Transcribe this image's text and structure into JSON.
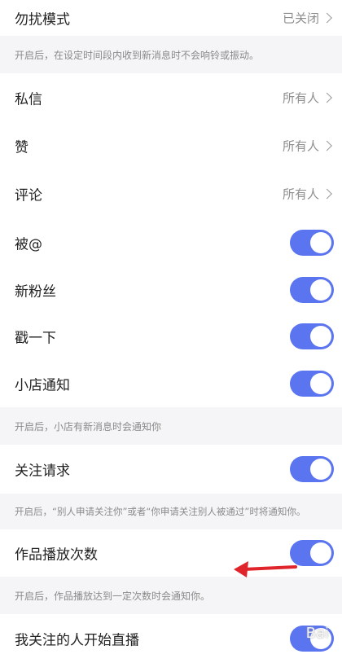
{
  "rows": {
    "dnd": {
      "label": "勿扰模式",
      "value": "已关闭"
    },
    "dnd_hint": "开启后，在设定时间段内收到新消息时不会响铃或振动。",
    "dm": {
      "label": "私信",
      "value": "所有人"
    },
    "likes": {
      "label": "赞",
      "value": "所有人"
    },
    "comments": {
      "label": "评论",
      "value": "所有人"
    },
    "mention": {
      "label": "被@",
      "toggle": true
    },
    "fans": {
      "label": "新粉丝",
      "toggle": true
    },
    "poke": {
      "label": "戳一下",
      "toggle": true
    },
    "shop": {
      "label": "小店通知",
      "toggle": true
    },
    "shop_hint": "开启后，小店有新消息时会通知你",
    "follow_req": {
      "label": "关注请求",
      "toggle": true
    },
    "follow_hint": "开启后，“别人申请关注你”或者“你申请关注别人被通过”时将通知你。",
    "plays": {
      "label": "作品播放次数",
      "toggle": true
    },
    "plays_hint": "开启后，作品播放达到一定次数时会通知你。",
    "live": {
      "label": "我关注的人开始直播",
      "toggle": true
    }
  },
  "colors": {
    "toggle_on": "#5b74ef",
    "annotation_arrow": "#e0242b",
    "hint_bg": "#f5f5f7"
  },
  "watermark": "Bai"
}
